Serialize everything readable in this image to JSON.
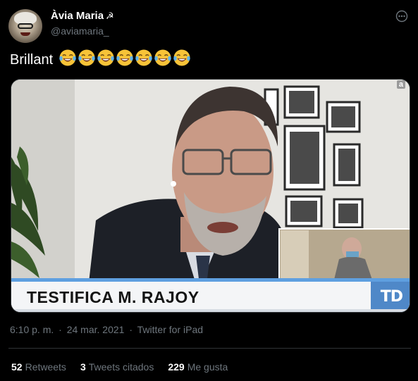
{
  "author": {
    "display_name": "Àvia Maria",
    "name_symbol": "☭",
    "handle": "@aviamaria_"
  },
  "tweet": {
    "text": "Brillant",
    "emoji": [
      "face-with-tears-of-joy",
      "face-with-tears-of-joy",
      "face-with-tears-of-joy",
      "face-with-tears-of-joy",
      "face-with-tears-of-joy",
      "face-with-tears-of-joy",
      "face-with-tears-of-joy"
    ],
    "emoji_count": 7
  },
  "media": {
    "chyron": "TESTIFICA M. RAJOY",
    "channel_logo": "TD",
    "corner_badge": "a"
  },
  "meta": {
    "time": "6:10 p. m.",
    "separator": "·",
    "date": "24 mar. 2021",
    "separator2": "·",
    "source": "Twitter for iPad"
  },
  "stats": {
    "retweets_count": "52",
    "retweets_label": "Retweets",
    "quotes_count": "3",
    "quotes_label": "Tweets citados",
    "likes_count": "229",
    "likes_label": "Me gusta"
  },
  "colors": {
    "background": "#000000",
    "text_primary": "#ffffff",
    "text_secondary": "#6e767d",
    "divider": "#2f3336",
    "chyron_accent": "#5e9fe0"
  }
}
